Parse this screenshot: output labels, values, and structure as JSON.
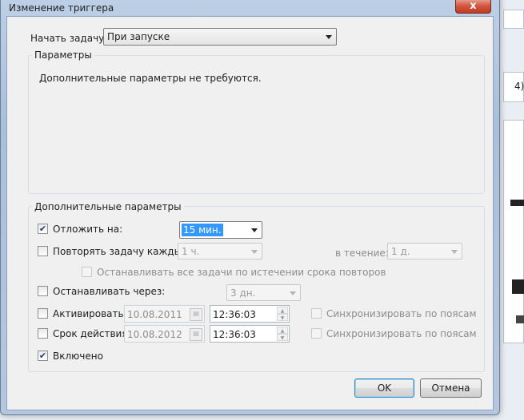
{
  "window": {
    "title": "Изменение триггера",
    "close_glyph": "x"
  },
  "start_task": {
    "label": "Начать задачу:",
    "value": "При запуске"
  },
  "params_group": {
    "title": "Параметры",
    "message": "Дополнительные параметры не требуются."
  },
  "advanced": {
    "title": "Дополнительные параметры",
    "delay": {
      "label": "Отложить на:",
      "checked": true,
      "value": "15 мин."
    },
    "repeat": {
      "label": "Повторять задачу каждые:",
      "checked": false,
      "value": "1 ч.",
      "duration_label": "в течение:",
      "duration_value": "1 д."
    },
    "stop_all": {
      "label": "Останавливать все задачи по истечении срока повторов",
      "checked": false
    },
    "stop_after": {
      "label": "Останавливать через:",
      "checked": false,
      "value": "3 дн."
    },
    "activate": {
      "label": "Активировать:",
      "checked": false,
      "date": "10.08.2011",
      "time": "12:36:03",
      "sync_label": "Синхронизировать по поясам"
    },
    "expire": {
      "label": "Срок действия:",
      "checked": false,
      "date": "10.08.2012",
      "time": "12:36:03",
      "sync_label": "Синхронизировать по поясам"
    },
    "enabled": {
      "label": "Включено",
      "checked": true
    }
  },
  "buttons": {
    "ok": "OK",
    "cancel": "Отмена"
  },
  "background": {
    "visible_text": "4)"
  },
  "colors": {
    "selection": "#3399ff",
    "title_bg": "#b4c7de",
    "close_red": "#c7432a"
  }
}
